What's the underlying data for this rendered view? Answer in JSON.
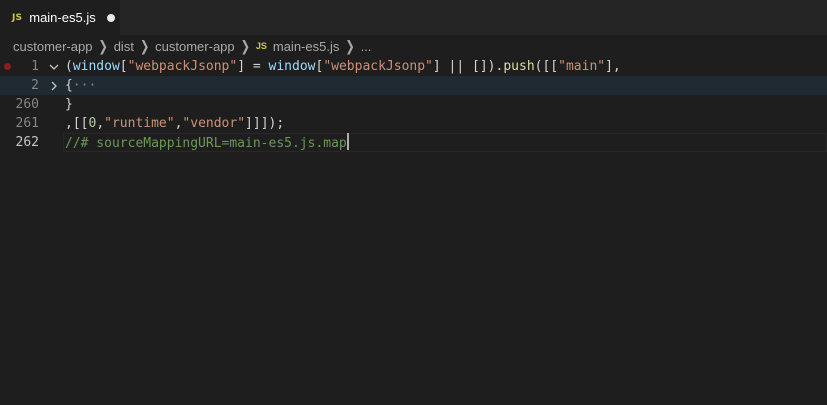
{
  "tab": {
    "icon_label": "JS",
    "title": "main-es5.js"
  },
  "breadcrumb": {
    "items": [
      "customer-app",
      "dist",
      "customer-app"
    ],
    "file_icon_label": "JS",
    "file": "main-es5.js",
    "more": "..."
  },
  "editor": {
    "line_numbers": [
      "1",
      "2",
      "260",
      "261",
      "262"
    ],
    "line1": {
      "p1": "(",
      "p2": "window",
      "p3": "[",
      "p4": "\"webpackJsonp\"",
      "p5": "] = ",
      "p6": "window",
      "p7": "[",
      "p8": "\"webpackJsonp\"",
      "p9": "] || []).",
      "p10": "push",
      "p11": "([[",
      "p12": "\"main\"",
      "p13": "],"
    },
    "line2": {
      "brace": "{",
      "ellipsis": "···"
    },
    "line260": {
      "text": "}"
    },
    "line261": {
      "p1": ",[[",
      "p2": "0",
      "p3": ",",
      "p4": "\"runtime\"",
      "p5": ",",
      "p6": "\"vendor\"",
      "p7": "]]]);"
    },
    "line262": {
      "comment": "//# sourceMappingURL=main-es5.js.map"
    }
  }
}
